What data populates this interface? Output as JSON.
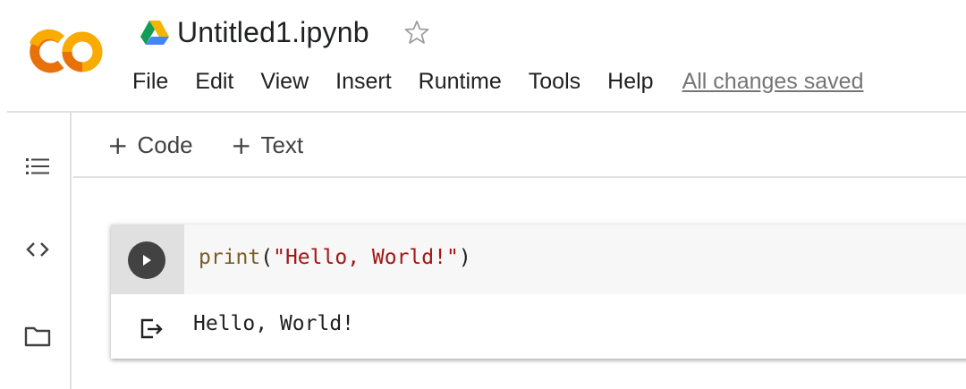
{
  "header": {
    "doc_title": "Untitled1.ipynb",
    "save_status": "All changes saved",
    "menu": [
      "File",
      "Edit",
      "View",
      "Insert",
      "Runtime",
      "Tools",
      "Help"
    ]
  },
  "toolbar": {
    "add_code_label": "Code",
    "add_text_label": "Text"
  },
  "sidebar": {
    "items": [
      "table-of-contents",
      "code-snippets",
      "files"
    ]
  },
  "cell": {
    "code": {
      "fn": "print",
      "open": "(",
      "string": "\"Hello, World!\"",
      "close": ")"
    },
    "output": "Hello, World!"
  },
  "colors": {
    "logo_orange": "#F9AB00",
    "logo_dark_orange": "#E8710A",
    "drive_green": "#0F9D58",
    "drive_blue": "#4285F4",
    "drive_yellow": "#F4B400",
    "code_string": "#A31515",
    "code_function": "#795E26"
  }
}
